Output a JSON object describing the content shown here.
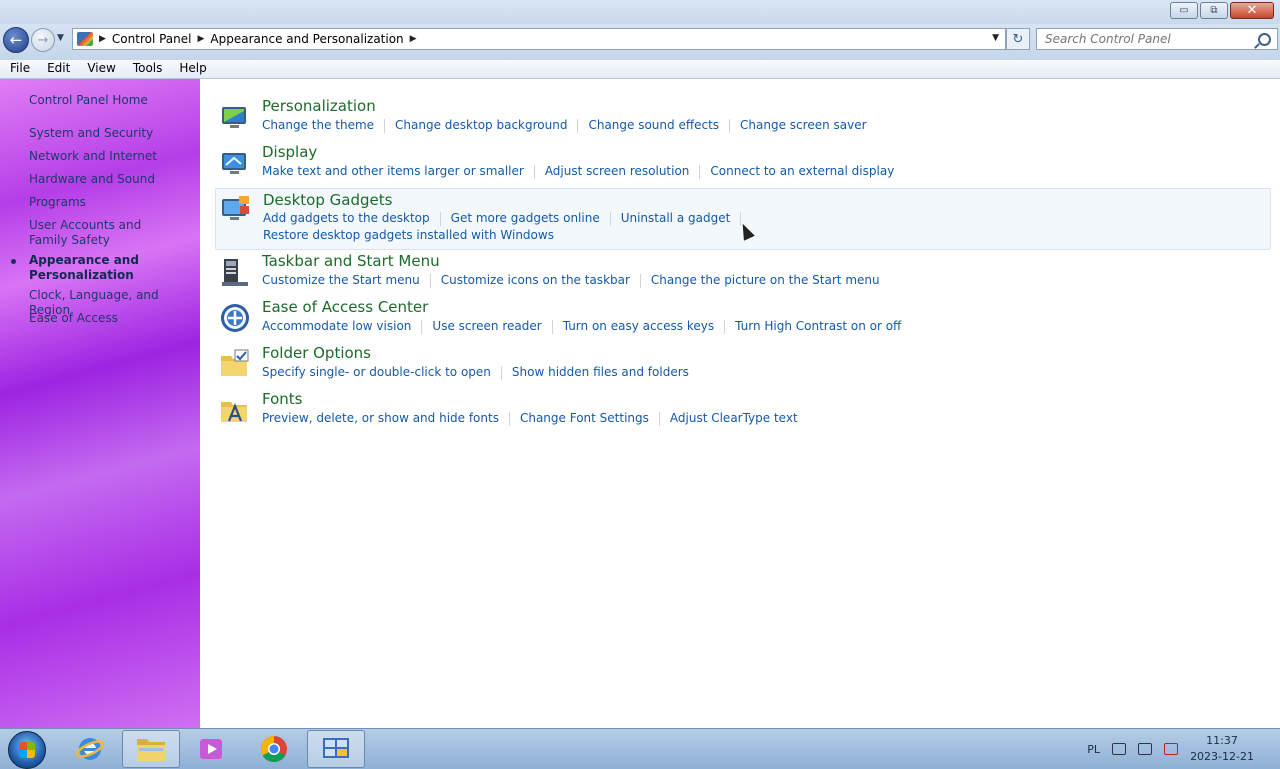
{
  "window": {
    "minimize": "▭",
    "maximize": "⧉",
    "close": "✕"
  },
  "nav": {
    "back_icon": "back-arrow-icon",
    "forward_icon": "forward-arrow-icon",
    "breadcrumbs": [
      "Control Panel",
      "Appearance and Personalization"
    ],
    "search_placeholder": "Search Control Panel"
  },
  "menu": [
    "File",
    "Edit",
    "View",
    "Tools",
    "Help"
  ],
  "sidebar": {
    "home": "Control Panel Home",
    "items": [
      "System and Security",
      "Network and Internet",
      "Hardware and Sound",
      "Programs",
      "User Accounts and Family Safety",
      "Appearance and Personalization",
      "Clock, Language, and Region",
      "Ease of Access"
    ],
    "current_index": 5
  },
  "categories": [
    {
      "title": "Personalization",
      "icon": "personalization-icon",
      "rows": [
        [
          "Change the theme",
          "Change desktop background",
          "Change sound effects",
          "Change screen saver"
        ]
      ]
    },
    {
      "title": "Display",
      "icon": "display-icon",
      "rows": [
        [
          "Make text and other items larger or smaller",
          "Adjust screen resolution",
          "Connect to an external display"
        ]
      ]
    },
    {
      "title": "Desktop Gadgets",
      "icon": "gadgets-icon",
      "rows": [
        [
          "Add gadgets to the desktop",
          "Get more gadgets online",
          "Uninstall a gadget"
        ],
        [
          "Restore desktop gadgets installed with Windows"
        ]
      ]
    },
    {
      "title": "Taskbar and Start Menu",
      "icon": "taskbar-icon",
      "rows": [
        [
          "Customize the Start menu",
          "Customize icons on the taskbar",
          "Change the picture on the Start menu"
        ]
      ]
    },
    {
      "title": "Ease of Access Center",
      "icon": "ease-of-access-icon",
      "rows": [
        [
          "Accommodate low vision",
          "Use screen reader",
          "Turn on easy access keys",
          "Turn High Contrast on or off"
        ]
      ]
    },
    {
      "title": "Folder Options",
      "icon": "folder-options-icon",
      "rows": [
        [
          "Specify single- or double-click to open",
          "Show hidden files and folders"
        ]
      ]
    },
    {
      "title": "Fonts",
      "icon": "fonts-icon",
      "rows": [
        [
          "Preview, delete, or show and hide fonts",
          "Change Font Settings",
          "Adjust ClearType text"
        ]
      ]
    }
  ],
  "taskbar": {
    "apps": [
      "internet-explorer-icon",
      "file-explorer-icon",
      "media-player-icon",
      "chrome-icon",
      "control-panel-icon"
    ],
    "language": "PL",
    "time": "11:37",
    "date": "2023-12-21"
  }
}
